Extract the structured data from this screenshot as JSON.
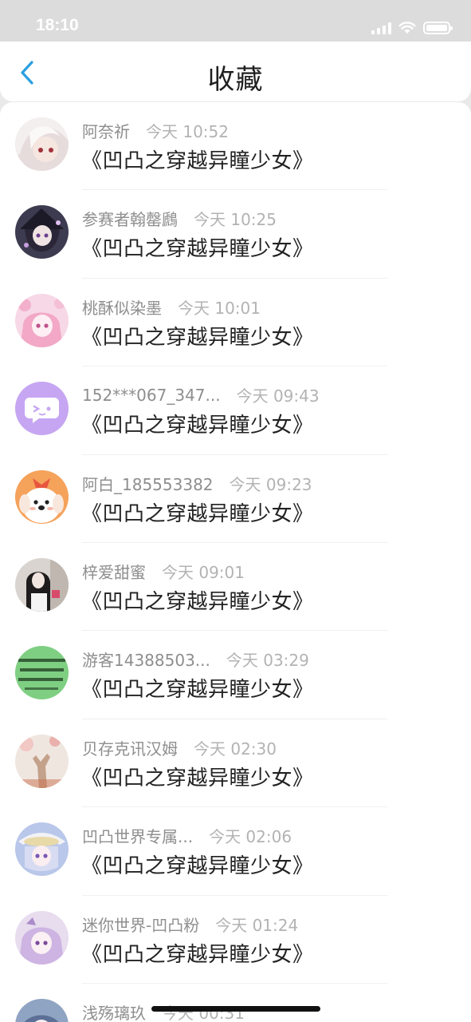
{
  "status_bar": {
    "time": "18:10"
  },
  "nav": {
    "title": "收藏"
  },
  "colors": {
    "accent": "#2a9fe0",
    "background": "#ffffff"
  },
  "items": [
    {
      "name": "阿奈祈",
      "time": "今天 10:52",
      "title": "《凹凸之穿越异瞳少女》",
      "avatar": "anime-white-hair"
    },
    {
      "name": "参赛者翰罄鷉",
      "time": "今天 10:25",
      "title": "《凹凸之穿越异瞳少女》",
      "avatar": "anime-dark"
    },
    {
      "name": "桃酥似染墨",
      "time": "今天 10:01",
      "title": "《凹凸之穿越异瞳少女》",
      "avatar": "anime-pink"
    },
    {
      "name": "152***067_347...",
      "time": "今天 09:43",
      "title": "《凹凸之穿越异瞳少女》",
      "avatar": "purple-chat-icon"
    },
    {
      "name": "阿白_185553382",
      "time": "今天 09:23",
      "title": "《凹凸之穿越异瞳少女》",
      "avatar": "cartoon-dog"
    },
    {
      "name": "梓爱甜蜜",
      "time": "今天 09:01",
      "title": "《凹凸之穿越异瞳少女》",
      "avatar": "photo-girl"
    },
    {
      "name": "游客14388503...",
      "time": "今天 03:29",
      "title": "《凹凸之穿越异瞳少女》",
      "avatar": "green-text"
    },
    {
      "name": "贝存克讯汉姆",
      "time": "今天 02:30",
      "title": "《凹凸之穿越异瞳少女》",
      "avatar": "photo-hand"
    },
    {
      "name": "凹凸世界专属...",
      "time": "今天 02:06",
      "title": "《凹凸之穿越异瞳少女》",
      "avatar": "anime-hat"
    },
    {
      "name": "迷你世界-凹凸粉",
      "time": "今天 01:24",
      "title": "《凹凸之穿越异瞳少女》",
      "avatar": "anime-lilac"
    },
    {
      "name": "浅殇璃玖",
      "time": "今天 00:31",
      "title": "",
      "avatar": "anime-blue"
    }
  ]
}
